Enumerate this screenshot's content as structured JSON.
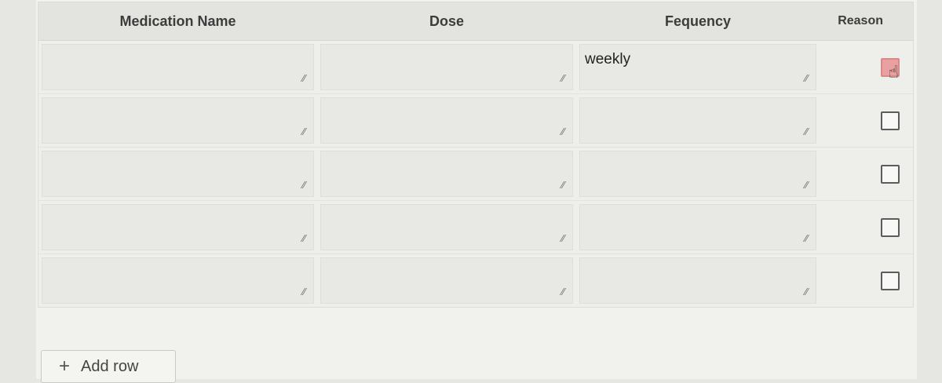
{
  "table": {
    "headers": {
      "name": "Medication Name",
      "dose": "Dose",
      "frequency": "Fequency",
      "reason": "Reason"
    },
    "rows": [
      {
        "name": "",
        "dose": "",
        "frequency": "weekly",
        "reason_checked": false,
        "reason_hover": true
      },
      {
        "name": "",
        "dose": "",
        "frequency": "",
        "reason_checked": false,
        "reason_hover": false
      },
      {
        "name": "",
        "dose": "",
        "frequency": "",
        "reason_checked": false,
        "reason_hover": false
      },
      {
        "name": "",
        "dose": "",
        "frequency": "",
        "reason_checked": false,
        "reason_hover": false
      },
      {
        "name": "",
        "dose": "",
        "frequency": "",
        "reason_checked": false,
        "reason_hover": false
      }
    ]
  },
  "add_row": {
    "icon": "plus-icon",
    "label": "Add row"
  },
  "colors": {
    "checkbox_hover": "#e8a0a0"
  }
}
